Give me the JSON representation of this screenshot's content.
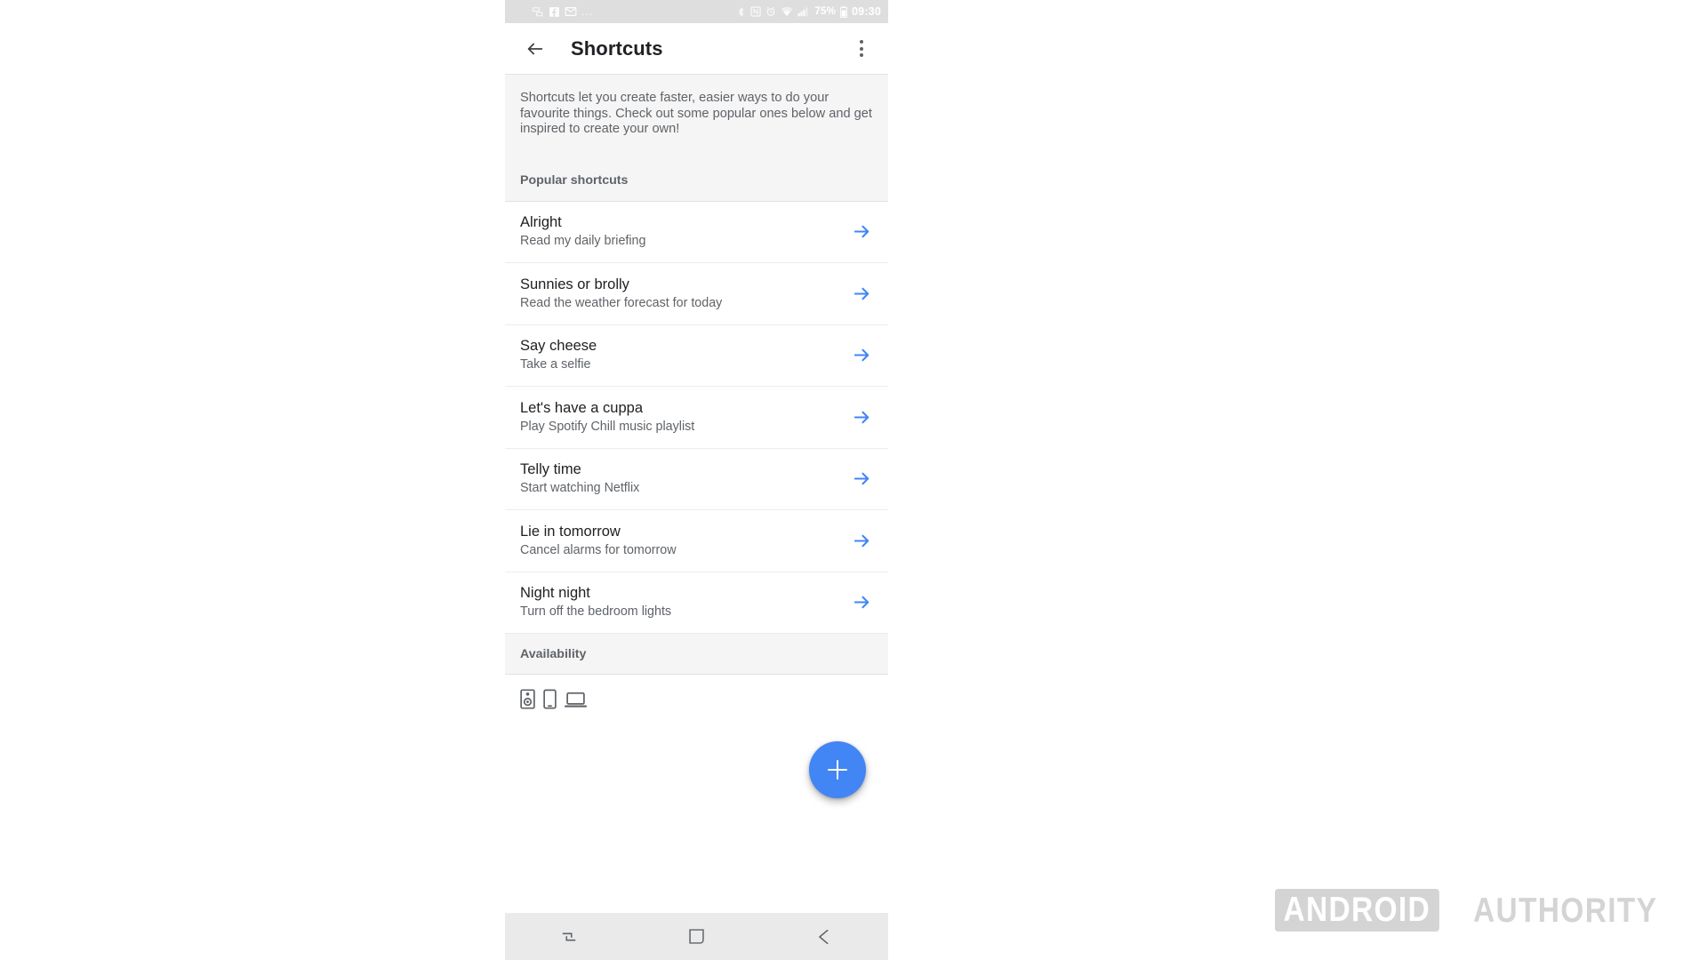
{
  "statusbar": {
    "left_icons": [
      "screen-share-icon",
      "facebook-icon",
      "gmail-icon"
    ],
    "overflow_dots": "...",
    "right_icons": [
      "bluetooth-icon",
      "nfc-icon",
      "alarm-icon",
      "wifi-icon",
      "signal-icon",
      "battery-icon"
    ],
    "battery_percent": "75%",
    "time": "09:30"
  },
  "appbar": {
    "back_label": "back-arrow",
    "title": "Shortcuts",
    "menu_label": "more-options"
  },
  "intro": {
    "text": "Shortcuts let you create faster, easier ways to do your favourite things. Check out some popular ones below and get inspired to create your own!"
  },
  "sections": {
    "popular_label": "Popular shortcuts",
    "availability_label": "Availability"
  },
  "shortcuts": [
    {
      "title": "Alright",
      "subtitle": "Read my daily briefing"
    },
    {
      "title": "Sunnies or brolly",
      "subtitle": "Read the weather forecast for today"
    },
    {
      "title": "Say cheese",
      "subtitle": "Take a selfie"
    },
    {
      "title": "Let's have a cuppa",
      "subtitle": "Play Spotify Chill music playlist"
    },
    {
      "title": "Telly time",
      "subtitle": "Start watching Netflix"
    },
    {
      "title": "Lie in tomorrow",
      "subtitle": "Cancel alarms for tomorrow"
    },
    {
      "title": "Night night",
      "subtitle": "Turn off the bedroom lights"
    }
  ],
  "availability": {
    "devices": [
      "speaker-icon",
      "phone-icon",
      "laptop-icon"
    ]
  },
  "fab": {
    "label": "add-shortcut"
  },
  "navbar": {
    "recents_label": "recents",
    "home_label": "home",
    "back_label": "back"
  },
  "watermark": {
    "part1": "ANDROID",
    "part2": "AUTHORITY"
  },
  "colors": {
    "accent": "#4285f4",
    "statusbar_bg": "#dedede",
    "section_bg": "#f5f5f5",
    "navbar_bg": "#eaeaea",
    "title_text": "#202124",
    "secondary_text": "#5f6368",
    "watermark": "#d4d4d4"
  }
}
